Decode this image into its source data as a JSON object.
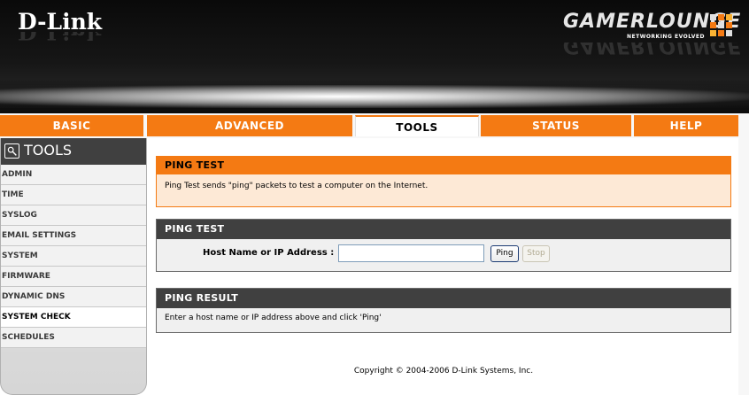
{
  "banner": {
    "brand": "D-Link",
    "product": "GAMERLOUNGE",
    "product_tagline": "NETWORKING EVOLVED"
  },
  "nav": {
    "tabs": [
      {
        "label": "BASIC",
        "active": false
      },
      {
        "label": "ADVANCED",
        "active": false
      },
      {
        "label": "TOOLS",
        "active": true
      },
      {
        "label": "STATUS",
        "active": false
      },
      {
        "label": "HELP",
        "active": false
      }
    ]
  },
  "sidebar": {
    "title": "TOOLS",
    "items": [
      {
        "label": "ADMIN"
      },
      {
        "label": "TIME"
      },
      {
        "label": "SYSLOG"
      },
      {
        "label": "EMAIL SETTINGS"
      },
      {
        "label": "SYSTEM"
      },
      {
        "label": "FIRMWARE"
      },
      {
        "label": "DYNAMIC DNS"
      },
      {
        "label": "SYSTEM CHECK",
        "selected": true
      },
      {
        "label": "SCHEDULES"
      }
    ]
  },
  "intro": {
    "title": "PING TEST",
    "description": "Ping Test sends \"ping\" packets to test a computer on the Internet."
  },
  "ping_test": {
    "title": "PING TEST",
    "host_label": "Host Name or IP Address :",
    "host_value": "",
    "ping_label": "Ping",
    "stop_label": "Stop"
  },
  "ping_result": {
    "title": "PING RESULT",
    "message": "Enter a host name or IP address above and click 'Ping'"
  },
  "footer": {
    "copyright": "Copyright © 2004-2006 D-Link Systems, Inc."
  },
  "colors": {
    "accent": "#f47a13",
    "dark_header": "#404040"
  }
}
